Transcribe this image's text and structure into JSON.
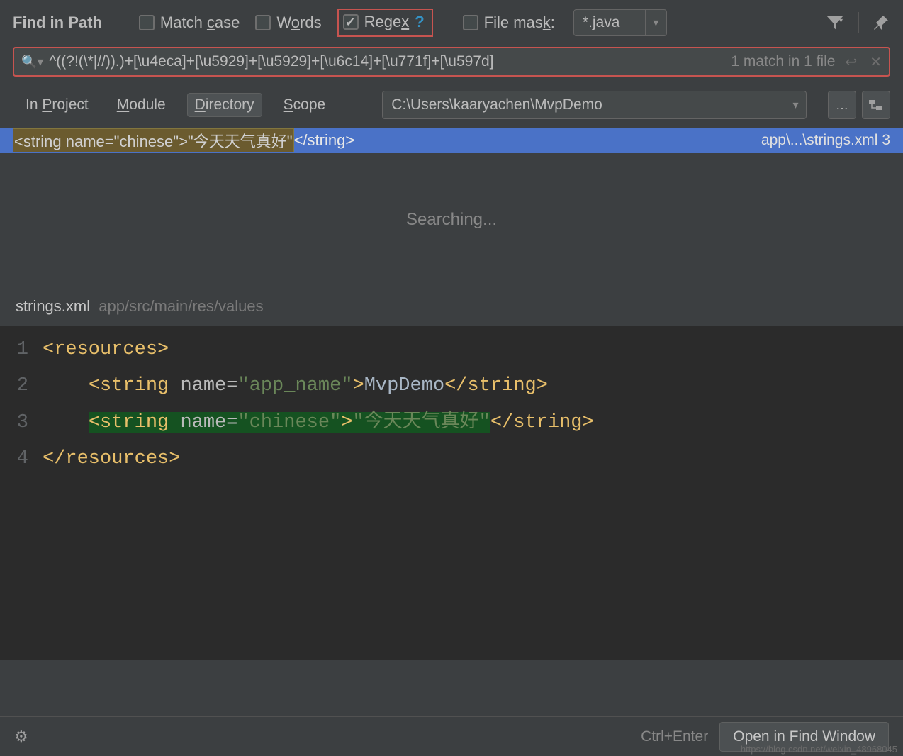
{
  "title": "Find in Path",
  "options": {
    "match_case": {
      "label_pre": "Match ",
      "letter": "c",
      "label_post": "ase",
      "checked": false
    },
    "words": {
      "label_pre": "W",
      "letter": "o",
      "label_post": "rds",
      "checked": false
    },
    "regex": {
      "label_pre": "Rege",
      "letter": "x",
      "label_post": "",
      "checked": true
    },
    "file_mask": {
      "label_pre": "File mas",
      "letter": "k",
      "label_post": ":",
      "checked": false
    },
    "file_mask_value": "*.java"
  },
  "search": {
    "query": "^((?!(\\*|//)).)+[\\u4eca]+[\\u5929]+[\\u5929]+[\\u6c14]+[\\u771f]+[\\u597d]",
    "match_info": "1 match in 1 file"
  },
  "scope": {
    "tabs": {
      "project_pre": "In ",
      "project_u": "P",
      "project_post": "roject",
      "module_u": "M",
      "module_post": "odule",
      "directory_u": "D",
      "directory_post": "irectory",
      "scope_u": "S",
      "scope_post": "cope"
    },
    "active": "directory",
    "path": "C:\\Users\\kaaryachen\\MvpDemo"
  },
  "result": {
    "highlighted_open": "<string name=\"chinese\">\"今天天气真好\"",
    "close_tag": "</string>",
    "file": "app\\...\\strings.xml",
    "line_no": "3"
  },
  "searching_text": "Searching...",
  "preview": {
    "filename": "strings.xml",
    "path": "app/src/main/res/values",
    "lines": [
      "1",
      "2",
      "3",
      "4"
    ],
    "code": {
      "l1": {
        "tag_open": "<resources>",
        "indent": ""
      },
      "l2": {
        "tag": "string",
        "attr": "name",
        "val": "\"app_name\"",
        "text": "MvpDemo",
        "indent": "    "
      },
      "l3": {
        "tag": "string",
        "attr": "name",
        "val": "\"chinese\"",
        "text": "\"今天天气真好\"",
        "indent": "    "
      },
      "l4": {
        "tag_close": "</resources>"
      }
    }
  },
  "bottom": {
    "shortcut": "Ctrl+Enter",
    "open_label": "Open in Find Window"
  },
  "watermark": "https://blog.csdn.net/weixin_48968045"
}
